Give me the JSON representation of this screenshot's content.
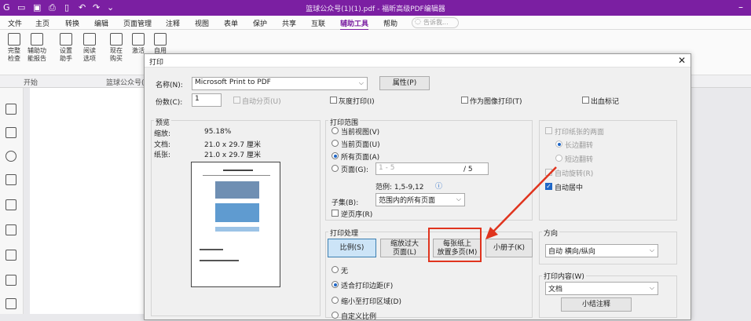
{
  "titlebar": {
    "title": "篮球公众号(1)(1).pdf - 福昕高级PDF编辑器",
    "accent": "#7b1fa2"
  },
  "menu": {
    "items": [
      "文件",
      "主页",
      "转换",
      "编辑",
      "页面管理",
      "注释",
      "视图",
      "表单",
      "保护",
      "共享",
      "互联",
      "辅助工具",
      "帮助"
    ],
    "active": "辅助工具",
    "search_placeholder": "告诉我..."
  },
  "ribbon": {
    "buttons": [
      {
        "label": "完整\n检查",
        "icon": "check-document-icon"
      },
      {
        "label": "辅助功\n能报告",
        "icon": "report-icon"
      },
      {
        "label": "设置\n助手",
        "icon": "setup-assistant-icon"
      },
      {
        "label": "阅读\n选项",
        "icon": "reading-options-icon"
      },
      {
        "label": "现在\n购买",
        "icon": "cart-icon"
      },
      {
        "label": "激活",
        "icon": "key-icon"
      },
      {
        "label": "自用",
        "icon": "doc-icon"
      }
    ]
  },
  "tabs": {
    "start": "开始",
    "doc": "篮球公众号(1)(1)..."
  },
  "dialog": {
    "title": "打印",
    "printer": {
      "name_label": "名称(N):",
      "name_value": "Microsoft Print to PDF",
      "properties_button": "属性(P)",
      "copies_label": "份数(C):",
      "copies_value": "1",
      "collate_label": "自动分页(U)",
      "grayscale_label": "灰度打印(I)",
      "as_image_label": "作为图像打印(T)",
      "bleed_label": "出血标记"
    },
    "preview": {
      "header": "预览",
      "zoom_label": "缩放:",
      "zoom_value": "95.18%",
      "doc_label": "文档:",
      "doc_value": "21.0 x 29.7 厘米",
      "paper_label": "纸张:",
      "paper_value": "21.0 x 29.7 厘米"
    },
    "range": {
      "header": "打印范围",
      "current_view": "当前视图(V)",
      "current_page": "当前页面(U)",
      "all_pages": "所有页面(A)",
      "pages": "页面(G):",
      "pages_value": "1 - 5",
      "total": "/ 5",
      "example": "范例: 1,5-9,12",
      "subset_label": "子集(B):",
      "subset_value": "范围内的所有页面",
      "reverse_label": "逆页序(R)"
    },
    "duplex": {
      "two_sided": "打印纸张的两面",
      "long_edge": "长边翻转",
      "short_edge": "短边翻转",
      "auto_rotate": "自动旋转(R)",
      "auto_center": "自动居中"
    },
    "handling": {
      "header": "打印处理",
      "tab_scale": "比例(S)",
      "tab_fit": "缩放过大\n页面(L)",
      "tab_multi": "每张纸上\n放置多页(M)",
      "tab_booklet": "小册子(K)",
      "opt_none": "无",
      "opt_fit_margins": "适合打印边距(F)",
      "opt_shrink": "缩小至打印区域(D)",
      "opt_custom": "自定义比例"
    },
    "orientation": {
      "header": "方向",
      "value": "自动 横向/纵向"
    },
    "content": {
      "header": "打印内容(W)",
      "value": "文档",
      "summary_button": "小结注释"
    },
    "highlight_color": "#e0341e"
  }
}
